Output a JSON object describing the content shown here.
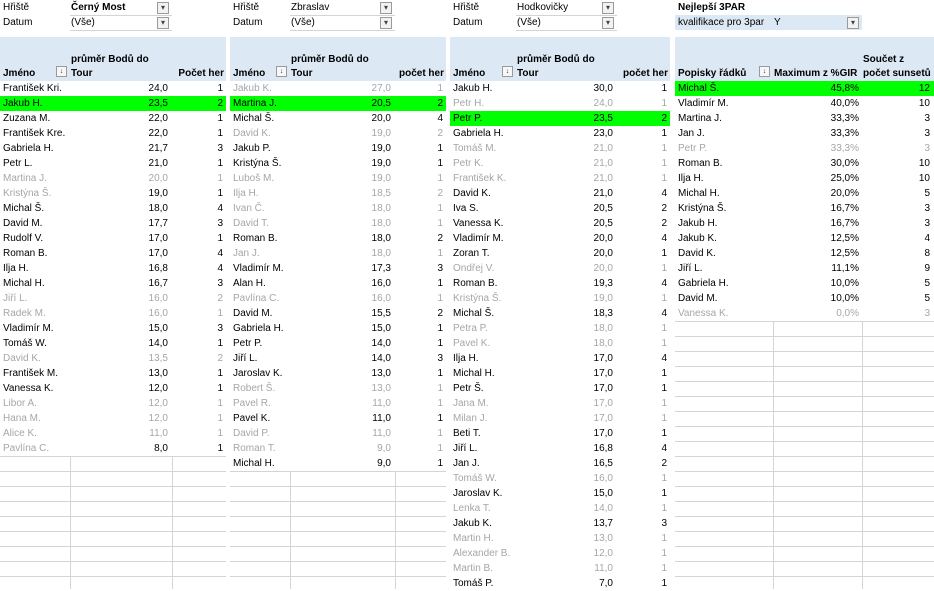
{
  "pivots": [
    {
      "filter1_label": "Hřiště",
      "filter1_value": "Černý Most",
      "filter2_label": "Datum",
      "filter2_value": "(Vše)",
      "header_top": "průměr Bodů do",
      "col1": "Jméno",
      "col2": "Tour",
      "col3": "Počet her",
      "rows": [
        {
          "name": "František Kri.",
          "val": "24,0",
          "cnt": "1",
          "style": ""
        },
        {
          "name": "Jakub H.",
          "val": "23,5",
          "cnt": "2",
          "style": "hl"
        },
        {
          "name": "Zuzana M.",
          "val": "22,0",
          "cnt": "1",
          "style": ""
        },
        {
          "name": "František Kre.",
          "val": "22,0",
          "cnt": "1",
          "style": ""
        },
        {
          "name": "Gabriela H.",
          "val": "21,7",
          "cnt": "3",
          "style": ""
        },
        {
          "name": "Petr L.",
          "val": "21,0",
          "cnt": "1",
          "style": ""
        },
        {
          "name": "Martina J.",
          "val": "20,0",
          "cnt": "1",
          "style": "dim"
        },
        {
          "name": "Kristýna Š.",
          "val": "19,0",
          "cnt": "1",
          "style": "dimname"
        },
        {
          "name": "Michal Š.",
          "val": "18,0",
          "cnt": "4",
          "style": ""
        },
        {
          "name": "David M.",
          "val": "17,7",
          "cnt": "3",
          "style": ""
        },
        {
          "name": "Rudolf V.",
          "val": "17,0",
          "cnt": "1",
          "style": ""
        },
        {
          "name": "Roman B.",
          "val": "17,0",
          "cnt": "4",
          "style": ""
        },
        {
          "name": "Ilja H.",
          "val": "16,8",
          "cnt": "4",
          "style": ""
        },
        {
          "name": "Michal H.",
          "val": "16,7",
          "cnt": "3",
          "style": ""
        },
        {
          "name": "Jiří L.",
          "val": "16,0",
          "cnt": "2",
          "style": "dim"
        },
        {
          "name": "Radek M.",
          "val": "16,0",
          "cnt": "1",
          "style": "dim"
        },
        {
          "name": "Vladimír M.",
          "val": "15,0",
          "cnt": "3",
          "style": ""
        },
        {
          "name": "Tomáš W.",
          "val": "14,0",
          "cnt": "1",
          "style": ""
        },
        {
          "name": "David K.",
          "val": "13,5",
          "cnt": "2",
          "style": "dim"
        },
        {
          "name": "František M.",
          "val": "13,0",
          "cnt": "1",
          "style": ""
        },
        {
          "name": "Vanessa K.",
          "val": "12,0",
          "cnt": "1",
          "style": ""
        },
        {
          "name": "Libor A.",
          "val": "12,0",
          "cnt": "1",
          "style": "dim"
        },
        {
          "name": "Hana M.",
          "val": "12,0",
          "cnt": "1",
          "style": "dim"
        },
        {
          "name": "Alice K.",
          "val": "11,0",
          "cnt": "1",
          "style": "dim"
        },
        {
          "name": "Pavlína C.",
          "val": "8,0",
          "cnt": "1",
          "style": "dimname"
        }
      ]
    },
    {
      "filter1_label": "Hřiště",
      "filter1_value": "Zbraslav",
      "filter2_label": "Datum",
      "filter2_value": "(Vše)",
      "header_top": "průměr Bodů do",
      "col1": "Jméno",
      "col2": "Tour",
      "col3": "počet her",
      "rows": [
        {
          "name": "Jakub K.",
          "val": "27,0",
          "cnt": "1",
          "style": "dim"
        },
        {
          "name": "Martina J.",
          "val": "20,5",
          "cnt": "2",
          "style": "hl"
        },
        {
          "name": "Michal Š.",
          "val": "20,0",
          "cnt": "4",
          "style": ""
        },
        {
          "name": "David K.",
          "val": "19,0",
          "cnt": "2",
          "style": "dim"
        },
        {
          "name": "Jakub P.",
          "val": "19,0",
          "cnt": "1",
          "style": ""
        },
        {
          "name": "Kristýna Š.",
          "val": "19,0",
          "cnt": "1",
          "style": ""
        },
        {
          "name": "Luboš M.",
          "val": "19,0",
          "cnt": "1",
          "style": "dim"
        },
        {
          "name": "Ilja H.",
          "val": "18,5",
          "cnt": "2",
          "style": "dim"
        },
        {
          "name": "Ivan Č.",
          "val": "18,0",
          "cnt": "1",
          "style": "dim"
        },
        {
          "name": "David T.",
          "val": "18,0",
          "cnt": "1",
          "style": "dim"
        },
        {
          "name": "Roman B.",
          "val": "18,0",
          "cnt": "2",
          "style": ""
        },
        {
          "name": "Jan J.",
          "val": "18,0",
          "cnt": "1",
          "style": "dim"
        },
        {
          "name": "Vladimír M.",
          "val": "17,3",
          "cnt": "3",
          "style": ""
        },
        {
          "name": "Alan H.",
          "val": "16,0",
          "cnt": "1",
          "style": ""
        },
        {
          "name": "Pavlína C.",
          "val": "16,0",
          "cnt": "1",
          "style": "dim"
        },
        {
          "name": "David M.",
          "val": "15,5",
          "cnt": "2",
          "style": ""
        },
        {
          "name": "Gabriela H.",
          "val": "15,0",
          "cnt": "1",
          "style": ""
        },
        {
          "name": "Petr P.",
          "val": "14,0",
          "cnt": "1",
          "style": ""
        },
        {
          "name": "Jiří L.",
          "val": "14,0",
          "cnt": "3",
          "style": ""
        },
        {
          "name": "Jaroslav K.",
          "val": "13,0",
          "cnt": "1",
          "style": ""
        },
        {
          "name": "Robert Š.",
          "val": "13,0",
          "cnt": "1",
          "style": "dim"
        },
        {
          "name": "Pavel R.",
          "val": "11,0",
          "cnt": "1",
          "style": "dim"
        },
        {
          "name": "Pavel K.",
          "val": "11,0",
          "cnt": "1",
          "style": ""
        },
        {
          "name": "David P.",
          "val": "11,0",
          "cnt": "1",
          "style": "dim"
        },
        {
          "name": "Roman T.",
          "val": "9,0",
          "cnt": "1",
          "style": "dim"
        },
        {
          "name": "Michal H.",
          "val": "9,0",
          "cnt": "1",
          "style": ""
        }
      ]
    },
    {
      "filter1_label": "Hřiště",
      "filter1_value": "Hodkovičky",
      "filter2_label": "Datum",
      "filter2_value": "(Vše)",
      "header_top": "průměr Bodů do",
      "col1": "Jméno",
      "col2": "Tour",
      "col3": "počet her",
      "rows": [
        {
          "name": "Jakub H.",
          "val": "30,0",
          "cnt": "1",
          "style": ""
        },
        {
          "name": "Petr H.",
          "val": "24,0",
          "cnt": "1",
          "style": "dim"
        },
        {
          "name": "Petr P.",
          "val": "23,5",
          "cnt": "2",
          "style": "hl"
        },
        {
          "name": "Gabriela H.",
          "val": "23,0",
          "cnt": "1",
          "style": ""
        },
        {
          "name": "Tomáš M.",
          "val": "21,0",
          "cnt": "1",
          "style": "dim"
        },
        {
          "name": "Petr K.",
          "val": "21,0",
          "cnt": "1",
          "style": "dim"
        },
        {
          "name": "František K.",
          "val": "21,0",
          "cnt": "1",
          "style": "dim"
        },
        {
          "name": "David K.",
          "val": "21,0",
          "cnt": "4",
          "style": ""
        },
        {
          "name": "Iva S.",
          "val": "20,5",
          "cnt": "2",
          "style": ""
        },
        {
          "name": "Vanessa K.",
          "val": "20,5",
          "cnt": "2",
          "style": ""
        },
        {
          "name": "Vladimír M.",
          "val": "20,0",
          "cnt": "4",
          "style": ""
        },
        {
          "name": "Zoran T.",
          "val": "20,0",
          "cnt": "1",
          "style": ""
        },
        {
          "name": "Ondřej V.",
          "val": "20,0",
          "cnt": "1",
          "style": "dim"
        },
        {
          "name": "Roman B.",
          "val": "19,3",
          "cnt": "4",
          "style": ""
        },
        {
          "name": "Kristýna Š.",
          "val": "19,0",
          "cnt": "1",
          "style": "dim"
        },
        {
          "name": "Michal Š.",
          "val": "18,3",
          "cnt": "4",
          "style": ""
        },
        {
          "name": "Petra P.",
          "val": "18,0",
          "cnt": "1",
          "style": "dim"
        },
        {
          "name": "Pavel K.",
          "val": "18,0",
          "cnt": "1",
          "style": "dim"
        },
        {
          "name": "Ilja H.",
          "val": "17,0",
          "cnt": "4",
          "style": ""
        },
        {
          "name": "Michal H.",
          "val": "17,0",
          "cnt": "1",
          "style": ""
        },
        {
          "name": "Petr Š.",
          "val": "17,0",
          "cnt": "1",
          "style": ""
        },
        {
          "name": "Jana M.",
          "val": "17,0",
          "cnt": "1",
          "style": "dim"
        },
        {
          "name": "Milan J.",
          "val": "17,0",
          "cnt": "1",
          "style": "dim"
        },
        {
          "name": "Beti T.",
          "val": "17,0",
          "cnt": "1",
          "style": ""
        },
        {
          "name": "Jiří L.",
          "val": "16,8",
          "cnt": "4",
          "style": ""
        },
        {
          "name": "Jan J.",
          "val": "16,5",
          "cnt": "2",
          "style": ""
        },
        {
          "name": "Tomáš W.",
          "val": "16,0",
          "cnt": "1",
          "style": "dim"
        },
        {
          "name": "Jaroslav K.",
          "val": "15,0",
          "cnt": "1",
          "style": ""
        },
        {
          "name": "Lenka T.",
          "val": "14,0",
          "cnt": "1",
          "style": "dim"
        },
        {
          "name": "Jakub K.",
          "val": "13,7",
          "cnt": "3",
          "style": ""
        },
        {
          "name": "Martin H.",
          "val": "13,0",
          "cnt": "1",
          "style": "dim"
        },
        {
          "name": "Alexander B.",
          "val": "12,0",
          "cnt": "1",
          "style": "dim"
        },
        {
          "name": "Martin B.",
          "val": "11,0",
          "cnt": "1",
          "style": "dim"
        },
        {
          "name": "Tomáš P.",
          "val": "7,0",
          "cnt": "1",
          "style": ""
        }
      ]
    }
  ],
  "pivot4": {
    "title": "Nejlepší 3PAR",
    "filter_label": "kvalifikace pro 3par",
    "filter_value": "Y",
    "header_top": "Součet z",
    "col1": "Popisky řádků",
    "col2": "Maximum z %GIR",
    "col3": "počet sunsetů",
    "rows": [
      {
        "name": "Michal Š.",
        "val": "45,8%",
        "cnt": "12",
        "style": "hl"
      },
      {
        "name": "Vladimír M.",
        "val": "40,0%",
        "cnt": "10",
        "style": ""
      },
      {
        "name": "Martina J.",
        "val": "33,3%",
        "cnt": "3",
        "style": ""
      },
      {
        "name": "Jan J.",
        "val": "33,3%",
        "cnt": "3",
        "style": ""
      },
      {
        "name": "Petr P.",
        "val": "33,3%",
        "cnt": "3",
        "style": "dim"
      },
      {
        "name": "Roman B.",
        "val": "30,0%",
        "cnt": "10",
        "style": ""
      },
      {
        "name": "Ilja H.",
        "val": "25,0%",
        "cnt": "10",
        "style": ""
      },
      {
        "name": "Michal H.",
        "val": "20,0%",
        "cnt": "5",
        "style": ""
      },
      {
        "name": "Kristýna Š.",
        "val": "16,7%",
        "cnt": "3",
        "style": ""
      },
      {
        "name": "Jakub H.",
        "val": "16,7%",
        "cnt": "3",
        "style": ""
      },
      {
        "name": "Jakub K.",
        "val": "12,5%",
        "cnt": "4",
        "style": ""
      },
      {
        "name": "David K.",
        "val": "12,5%",
        "cnt": "8",
        "style": ""
      },
      {
        "name": "Jiří L.",
        "val": "11,1%",
        "cnt": "9",
        "style": ""
      },
      {
        "name": "Gabriela H.",
        "val": "10,0%",
        "cnt": "5",
        "style": ""
      },
      {
        "name": "David M.",
        "val": "10,0%",
        "cnt": "5",
        "style": ""
      },
      {
        "name": "Vanessa K.",
        "val": "0,0%",
        "cnt": "3",
        "style": "dim"
      }
    ]
  },
  "icons": {
    "filter": "funnel-dropdown-icon",
    "dropdown": "chevron-down-icon",
    "sort": "sort-filter-icon"
  }
}
